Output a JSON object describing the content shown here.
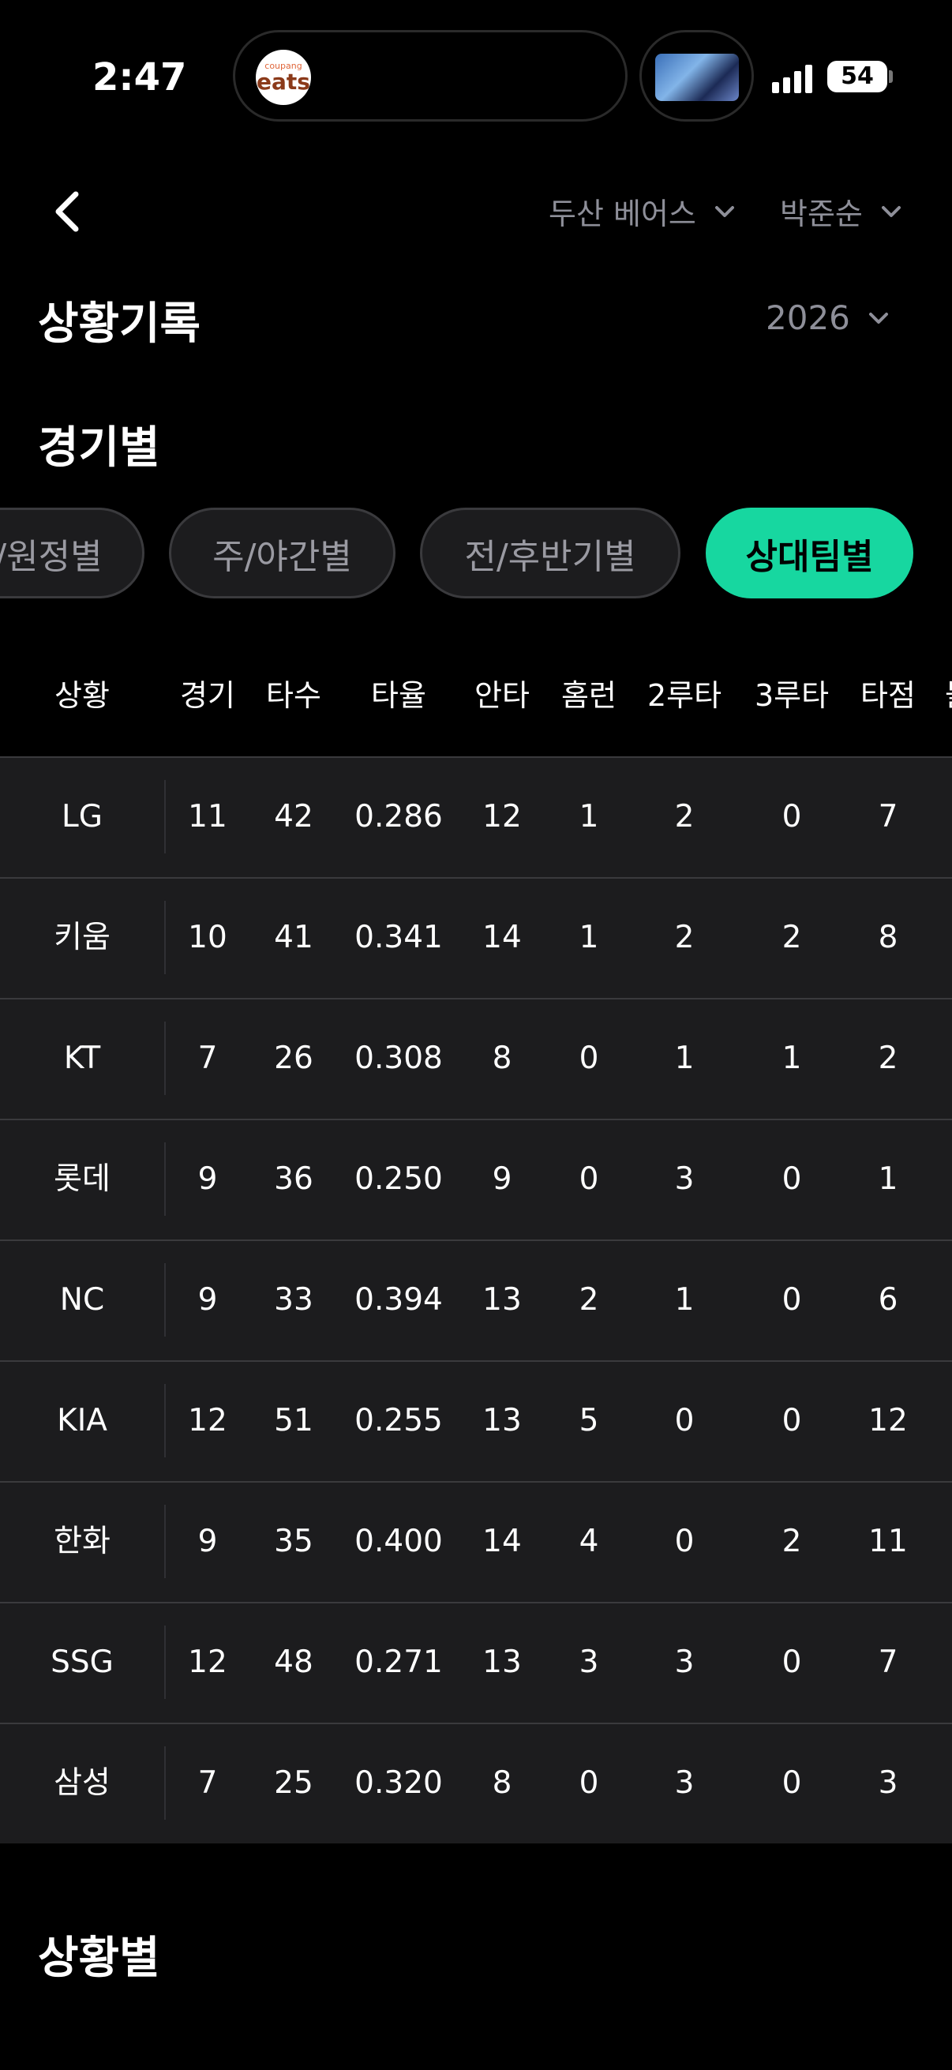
{
  "status_bar": {
    "time": "2:47",
    "battery": "54",
    "app_badge_small": "coupang",
    "app_badge_big": "eats"
  },
  "header": {
    "team_dropdown": "두산 베어스",
    "player_dropdown": "박준순",
    "title": "상황기록",
    "year_dropdown": "2026"
  },
  "section_game": "경기별",
  "filter_chips": [
    "/원정별",
    "주/야간별",
    "전/후반기별",
    "상대팀별"
  ],
  "active_chip": "상대팀별",
  "accent_color": "#17d7a0",
  "table": {
    "columns": [
      "상황",
      "경기",
      "타수",
      "타율",
      "안타",
      "홈런",
      "2루타",
      "3루타",
      "타점",
      "볼"
    ],
    "rows": [
      [
        "LG",
        "11",
        "42",
        "0.286",
        "12",
        "1",
        "2",
        "0",
        "7"
      ],
      [
        "키움",
        "10",
        "41",
        "0.341",
        "14",
        "1",
        "2",
        "2",
        "8"
      ],
      [
        "KT",
        "7",
        "26",
        "0.308",
        "8",
        "0",
        "1",
        "1",
        "2"
      ],
      [
        "롯데",
        "9",
        "36",
        "0.250",
        "9",
        "0",
        "3",
        "0",
        "1"
      ],
      [
        "NC",
        "9",
        "33",
        "0.394",
        "13",
        "2",
        "1",
        "0",
        "6"
      ],
      [
        "KIA",
        "12",
        "51",
        "0.255",
        "13",
        "5",
        "0",
        "0",
        "12"
      ],
      [
        "한화",
        "9",
        "35",
        "0.400",
        "14",
        "4",
        "0",
        "2",
        "11"
      ],
      [
        "SSG",
        "12",
        "48",
        "0.271",
        "13",
        "3",
        "3",
        "0",
        "7"
      ],
      [
        "삼성",
        "7",
        "25",
        "0.320",
        "8",
        "0",
        "3",
        "0",
        "3"
      ]
    ]
  },
  "section_situation": "상황별"
}
